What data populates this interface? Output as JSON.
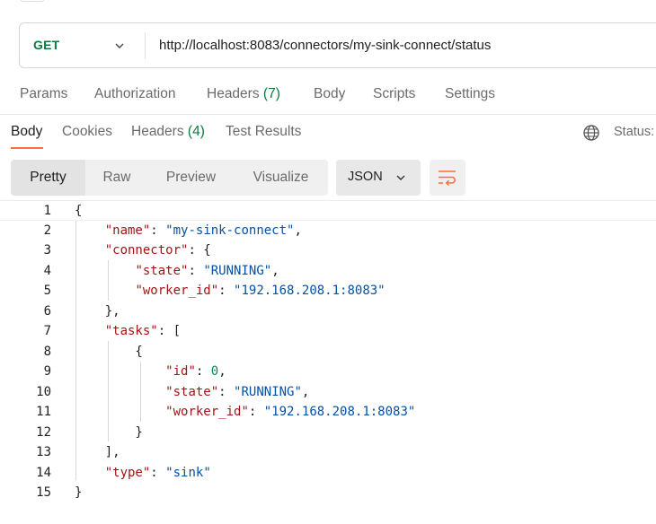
{
  "request": {
    "method": "GET",
    "url": "http://localhost:8083/connectors/my-sink-connect/status"
  },
  "request_tabs": [
    {
      "label": "Params"
    },
    {
      "label": "Authorization"
    },
    {
      "label": "Headers",
      "count": "(7)"
    },
    {
      "label": "Body"
    },
    {
      "label": "Scripts"
    },
    {
      "label": "Settings"
    }
  ],
  "response_tabs": [
    {
      "label": "Body"
    },
    {
      "label": "Cookies"
    },
    {
      "label": "Headers",
      "count": "(4)"
    },
    {
      "label": "Test Results"
    }
  ],
  "response_status": {
    "label": "Status:"
  },
  "view_modes": [
    "Pretty",
    "Raw",
    "Preview",
    "Visualize"
  ],
  "format": {
    "selected": "JSON"
  },
  "colors": {
    "accent": "#ff6c37",
    "method": "#0a7c3e",
    "json_key": "#a31515",
    "json_string": "#0451a5",
    "json_number": "#098658"
  },
  "icons": {
    "globe": "globe-icon",
    "wrap": "wrap-lines-icon",
    "chevron": "chevron-down-icon"
  },
  "code_lines": [
    {
      "n": "1",
      "text": "{"
    },
    {
      "n": "2",
      "text": "    \"name\": \"my-sink-connect\","
    },
    {
      "n": "3",
      "text": "    \"connector\": {"
    },
    {
      "n": "4",
      "text": "        \"state\": \"RUNNING\","
    },
    {
      "n": "5",
      "text": "        \"worker_id\": \"192.168.208.1:8083\""
    },
    {
      "n": "6",
      "text": "    },"
    },
    {
      "n": "7",
      "text": "    \"tasks\": ["
    },
    {
      "n": "8",
      "text": "        {"
    },
    {
      "n": "9",
      "text": "            \"id\": 0,"
    },
    {
      "n": "10",
      "text": "            \"state\": \"RUNNING\","
    },
    {
      "n": "11",
      "text": "            \"worker_id\": \"192.168.208.1:8083\""
    },
    {
      "n": "12",
      "text": "        }"
    },
    {
      "n": "13",
      "text": "    ],"
    },
    {
      "n": "14",
      "text": "    \"type\": \"sink\""
    },
    {
      "n": "15",
      "text": "}"
    }
  ]
}
